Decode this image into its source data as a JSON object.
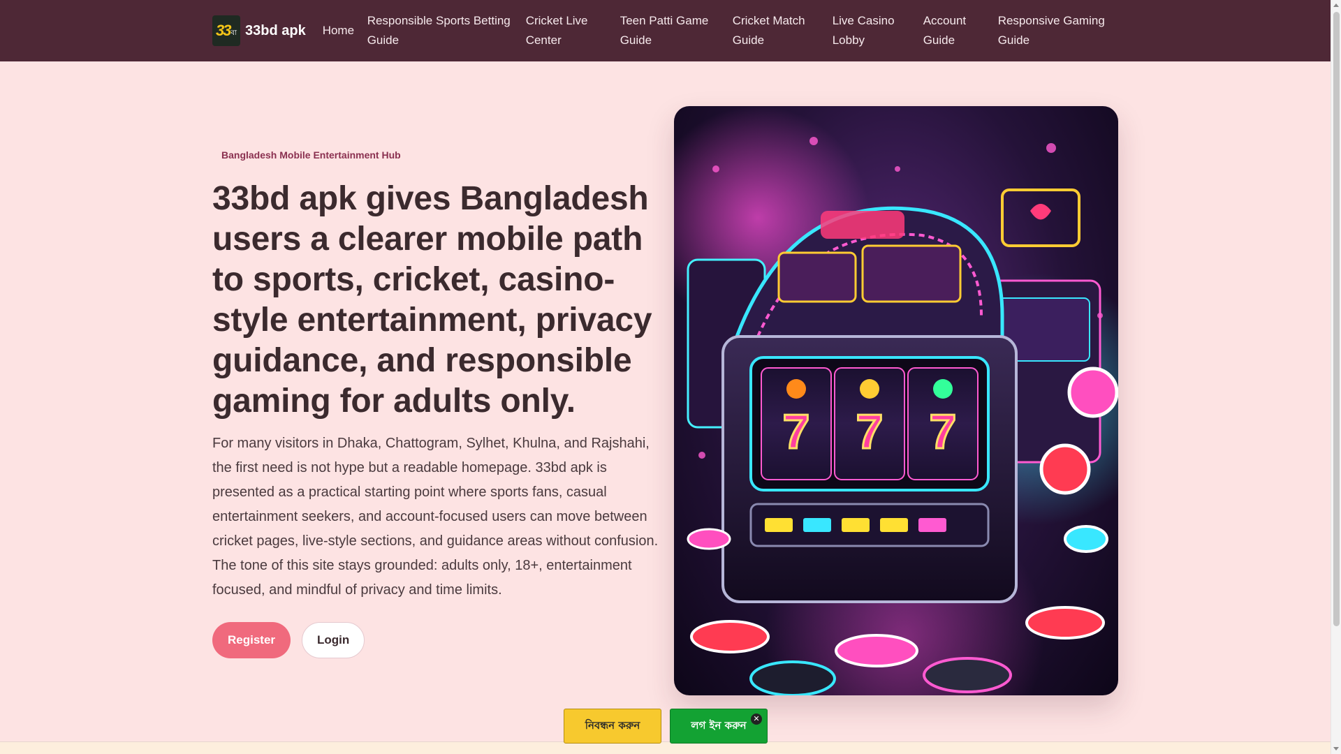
{
  "header": {
    "brand_name": "33bd apk",
    "logo_text": "33",
    "logo_sub": "বা",
    "nav": [
      {
        "label": "Home"
      },
      {
        "label": "Responsible Sports Betting Guide"
      },
      {
        "label": "Cricket Live Center"
      },
      {
        "label": "Teen Patti Game Guide"
      },
      {
        "label": "Cricket Match Guide"
      },
      {
        "label": "Live Casino Lobby"
      },
      {
        "label": "Account Guide"
      },
      {
        "label": "Responsive Gaming Guide"
      }
    ]
  },
  "hero": {
    "eyebrow": "Bangladesh Mobile Entertainment Hub",
    "headline": "33bd apk gives Bangladesh users a clearer mobile path to sports, cricket, casino-style entertainment, privacy guidance, and responsible gaming for adults only.",
    "lead": "For many visitors in Dhaka, Chattogram, Sylhet, Khulna, and Rajshahi, the first need is not hype but a readable homepage. 33bd apk is presented as a practical starting point where sports fans, casual entertainment seekers, and account-focused users can move between cricket pages, live-style sections, and guidance areas without confusion. The tone of this site stays grounded: adults only, 18+, entertainment focused, and mindful of privacy and time limits.",
    "register_label": "Register",
    "login_label": "Login",
    "image_reels": [
      "7",
      "7",
      "7"
    ]
  },
  "floating": {
    "register_label": "নিবন্ধন করুন",
    "login_label": "লগ ইন করুন",
    "close_symbol": "✕"
  },
  "colors": {
    "header_bg": "#4e2836",
    "page_bg": "#fde3e3",
    "accent": "#f06a7d",
    "float_register": "#f7c92e",
    "float_login": "#13a233"
  }
}
